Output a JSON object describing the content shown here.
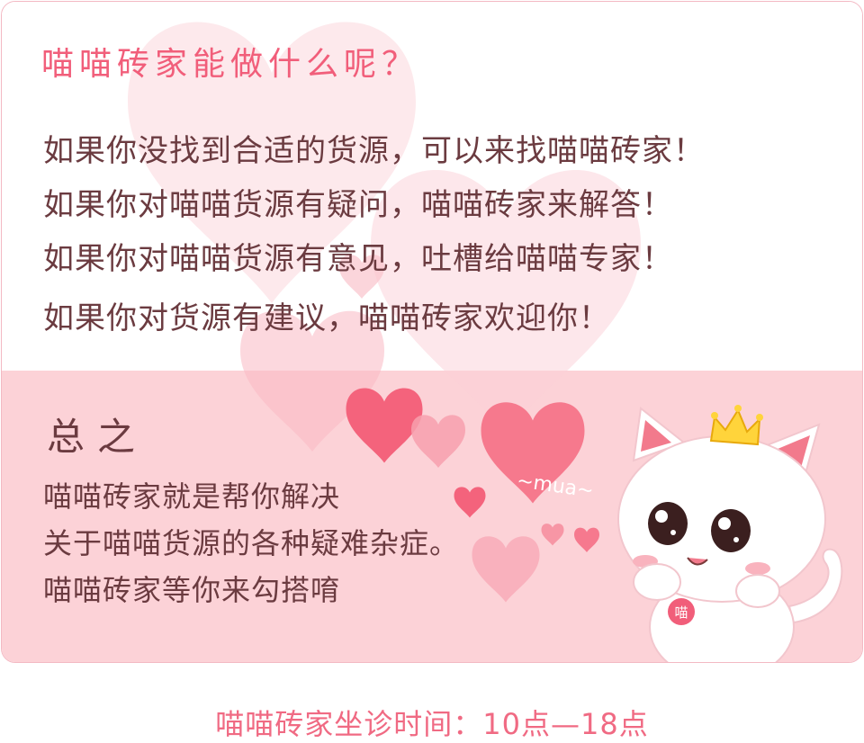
{
  "header": {
    "title": "喵喵砖家能做什么呢？"
  },
  "intro": {
    "lines": [
      "如果你没找到合适的货源，可以来找喵喵砖家！",
      "如果你对喵喵货源有疑问，喵喵砖家来解答！",
      "如果你对喵喵货源有意见，吐槽给喵喵专家！",
      "如果你对货源有建议，喵喵砖家欢迎你！"
    ]
  },
  "summary": {
    "title": "总之",
    "lines": [
      "喵喵砖家就是帮你解决",
      "关于喵喵货源的各种疑难杂症。",
      "喵喵砖家等你来勾搭唷"
    ]
  },
  "illustration": {
    "mua_text": "~mua~",
    "collar_text": "喵",
    "character": "white-cat-with-crown"
  },
  "footer": {
    "hours": "喵喵砖家坐诊时间：10点—18点"
  },
  "colors": {
    "accent": "#f15e7a",
    "text": "#6b3b40",
    "panel": "#fcd2d7",
    "heart": "#f46a80"
  }
}
